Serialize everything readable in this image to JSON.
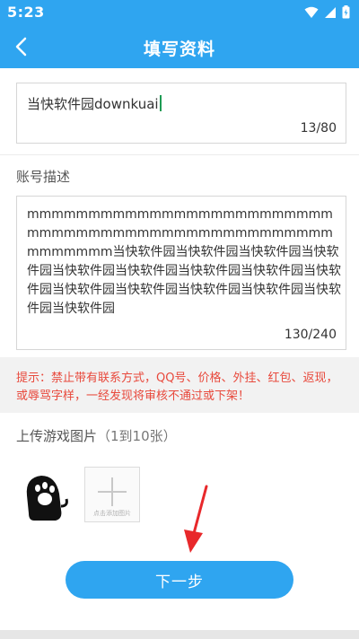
{
  "status_bar": {
    "time": "5:23"
  },
  "header": {
    "title": "填写资料"
  },
  "game_name": {
    "value": "当快软件园downkuai",
    "count": "13/80"
  },
  "account_desc": {
    "label": "账号描述",
    "value": "mmmmmmmmmmmmmmmmmmmmmmmmmmmmmmmmmmmmmmmmmmmmmmmmmmmmmmmmm当快软件园当快软件园当快软件园当快软件园当快软件园当快软件园当快软件园当快软件园当快软件园当快软件园当快软件园当快软件园当快软件园当快软件园当快软件园",
    "count": "130/240"
  },
  "notice": {
    "text": "提示：禁止带有联系方式，QQ号、价格、外挂、红包、返现，或辱骂字样，一经发现将审核不通过或下架！"
  },
  "upload": {
    "label": "上传游戏图片",
    "hint": "（1到10张）",
    "add_caption": "点击添加图片"
  },
  "actions": {
    "next_label": "下一步"
  },
  "colors": {
    "primary": "#2fa5f0",
    "warning": "#e8493c"
  }
}
